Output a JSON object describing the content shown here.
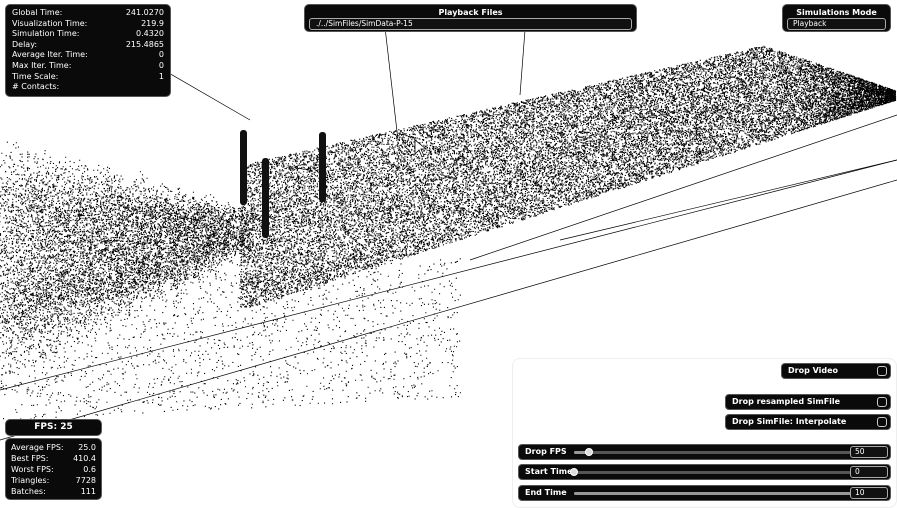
{
  "stats": {
    "rows": [
      {
        "label": "Global Time:",
        "value": "241.0270"
      },
      {
        "label": "Visualization Time:",
        "value": "219.9"
      },
      {
        "label": "Simulation Time:",
        "value": "0.4320"
      },
      {
        "label": "Delay:",
        "value": "215.4865"
      },
      {
        "label": "Average Iter. Time:",
        "value": "0"
      },
      {
        "label": "Max Iter. Time:",
        "value": "0"
      },
      {
        "label": "Time Scale:",
        "value": "1"
      },
      {
        "label": "# Contacts:",
        "value": ""
      }
    ]
  },
  "playback": {
    "title": "Playback Files",
    "file": "./../SimFiles/SimData-P-15"
  },
  "sim_mode": {
    "title": "Simulations Mode",
    "value": "Playback"
  },
  "fps": {
    "header": "FPS: 25",
    "rows": [
      {
        "label": "Average FPS:",
        "value": "25.0"
      },
      {
        "label": "Best FPS:",
        "value": "410.4"
      },
      {
        "label": "Worst FPS:",
        "value": "0.6"
      },
      {
        "label": "Triangles:",
        "value": "7728"
      },
      {
        "label": "Batches:",
        "value": "111"
      }
    ]
  },
  "controls": {
    "drop_video": "Drop Video",
    "drop_resampled": "Drop resampled SimFile",
    "drop_interpolate": "Drop SimFile: Interpolate",
    "drop_fps": {
      "label": "Drop FPS",
      "value": "50",
      "position": 0.05
    },
    "start_time": {
      "label": "Start Time",
      "value": "0",
      "position": 0.0
    },
    "end_time": {
      "label": "End Time",
      "value": "10",
      "position": 1.0
    }
  },
  "colors": {
    "panel_bg": "#0a0a0a",
    "particles": "#000000",
    "background": "#ffffff"
  }
}
